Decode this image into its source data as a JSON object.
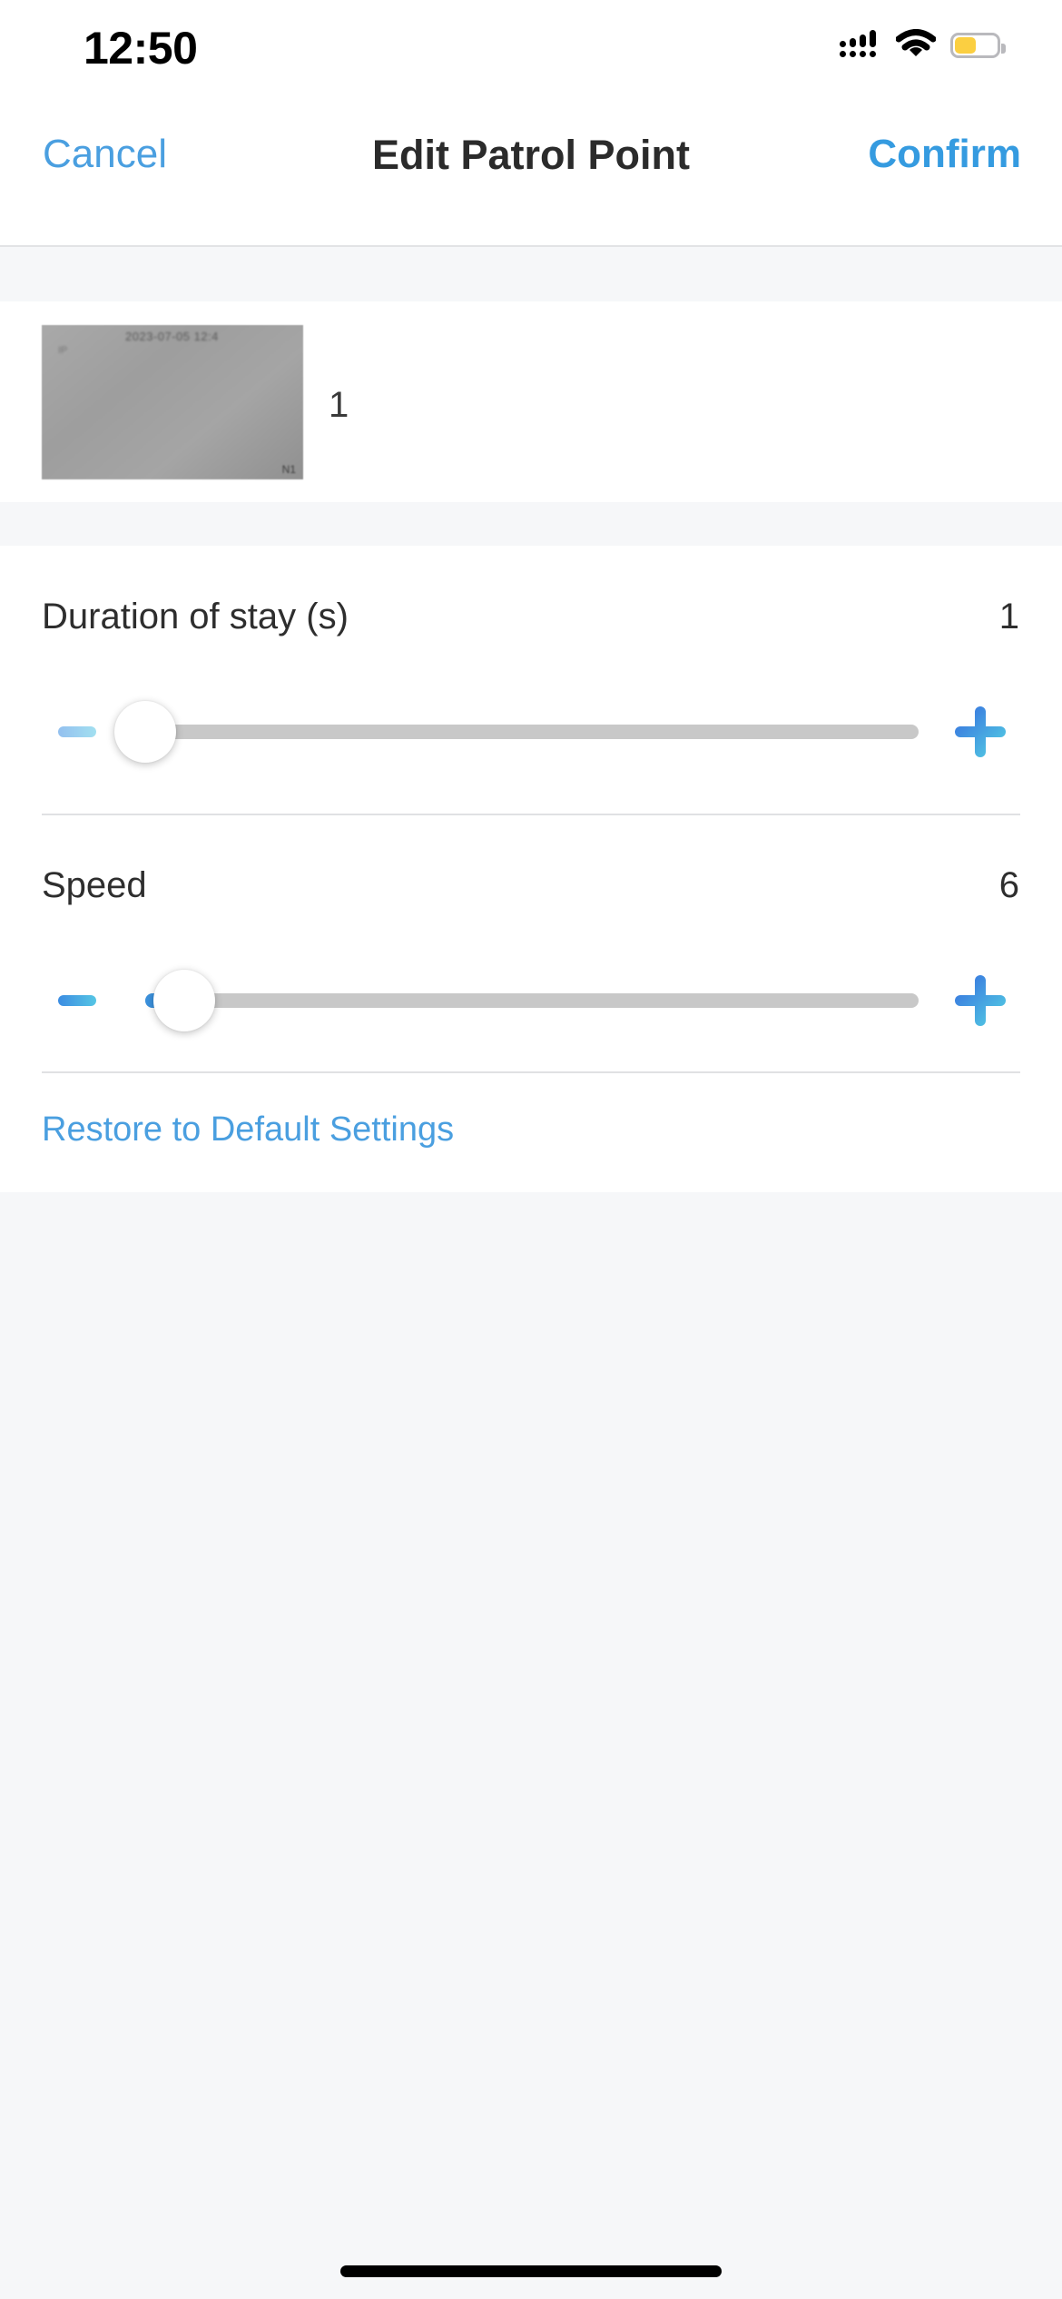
{
  "status_bar": {
    "time": "12:50",
    "cellular_icon": "cellular-signal-icon",
    "cellular_bars": 4,
    "wifi_icon": "wifi-icon",
    "battery_icon": "battery-icon",
    "battery_level_percent": 52,
    "battery_color": "#fbcf41"
  },
  "nav_bar": {
    "cancel_label": "Cancel",
    "title": "Edit Patrol Point",
    "confirm_label": "Confirm",
    "accent_color": "#4a9fe0"
  },
  "preview": {
    "thumbnail_name": "patrol-point-snapshot",
    "overlay_timestamp": "2023-07-05 12:4",
    "overlay_sub": "IP",
    "overlay_corner": "N1",
    "point_number": "1"
  },
  "settings": {
    "rows": [
      {
        "label": "Duration of stay (s)",
        "value": "1",
        "minus_label": "−",
        "plus_label": "+",
        "fill_percent": 0,
        "thumb_percent": 0,
        "minus_disabled": true
      },
      {
        "label": "Speed",
        "value": "6",
        "minus_label": "−",
        "plus_label": "+",
        "fill_percent": 5,
        "thumb_percent": 5,
        "minus_disabled": false
      }
    ],
    "restore_label": "Restore to Default Settings",
    "link_color": "#4a9fe0",
    "slider_fill_color": "#3b91dd",
    "slider_track_color": "#c8c8c8"
  },
  "home_indicator": "home-indicator"
}
